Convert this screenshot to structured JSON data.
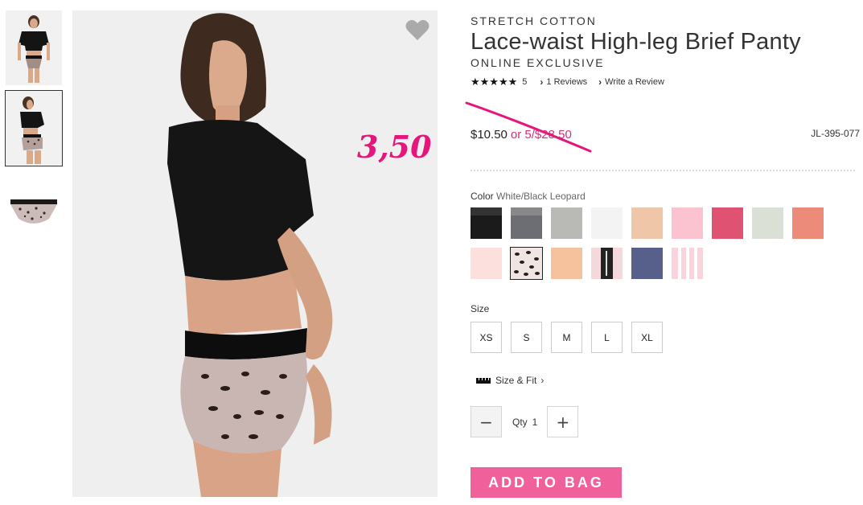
{
  "thumbnails": [
    {
      "label": "thumbnail-front"
    },
    {
      "label": "thumbnail-back"
    },
    {
      "label": "thumbnail-flat"
    }
  ],
  "annotation": {
    "price": "3,50",
    "color": "#e5157b"
  },
  "product": {
    "collection": "STRETCH COTTON",
    "title": "Lace-waist High-leg Brief Panty",
    "exclusive": "ONLINE EXCLUSIVE",
    "stars": "★★★★★",
    "rating": "5",
    "reviews_link": "1 Reviews",
    "write_review": "Write a Review",
    "price_now": "$10.50",
    "price_was": "or 5/$28.50",
    "sku": "JL-395-077"
  },
  "color": {
    "label": "Color",
    "selected": "White/Black Leopard",
    "swatches": [
      {
        "name": "black-lace",
        "color": "#1b1b1b"
      },
      {
        "name": "grey-lace",
        "color": "#6d6e73"
      },
      {
        "name": "heather-grey",
        "color": "#b9b9b6"
      },
      {
        "name": "white",
        "color": "#f3f3f3"
      },
      {
        "name": "nude",
        "color": "#efc6a8"
      },
      {
        "name": "light-pink",
        "color": "#fac3cf"
      },
      {
        "name": "hot-pink",
        "color": "#df5272"
      },
      {
        "name": "mint-grey",
        "color": "#dbe0d6"
      },
      {
        "name": "coral",
        "color": "#ec8b7a"
      },
      {
        "name": "blush",
        "color": "#fbe0dd"
      },
      {
        "name": "white-black-leopard",
        "color": "#efe6e4"
      },
      {
        "name": "peach-print",
        "color": "#f6c29e"
      },
      {
        "name": "black-logo-stripe",
        "color": "#222222"
      },
      {
        "name": "navy",
        "color": "#56608a"
      },
      {
        "name": "pink-stripe",
        "color": "#fbd3dc"
      }
    ]
  },
  "size": {
    "label": "Size",
    "options": [
      "XS",
      "S",
      "M",
      "L",
      "XL"
    ],
    "fit_link": "Size & Fit"
  },
  "quantity": {
    "label": "Qty",
    "value": "1",
    "minus": "−",
    "plus": "+"
  },
  "cta": {
    "add_to_bag": "ADD TO BAG",
    "color": "#f0609b"
  }
}
